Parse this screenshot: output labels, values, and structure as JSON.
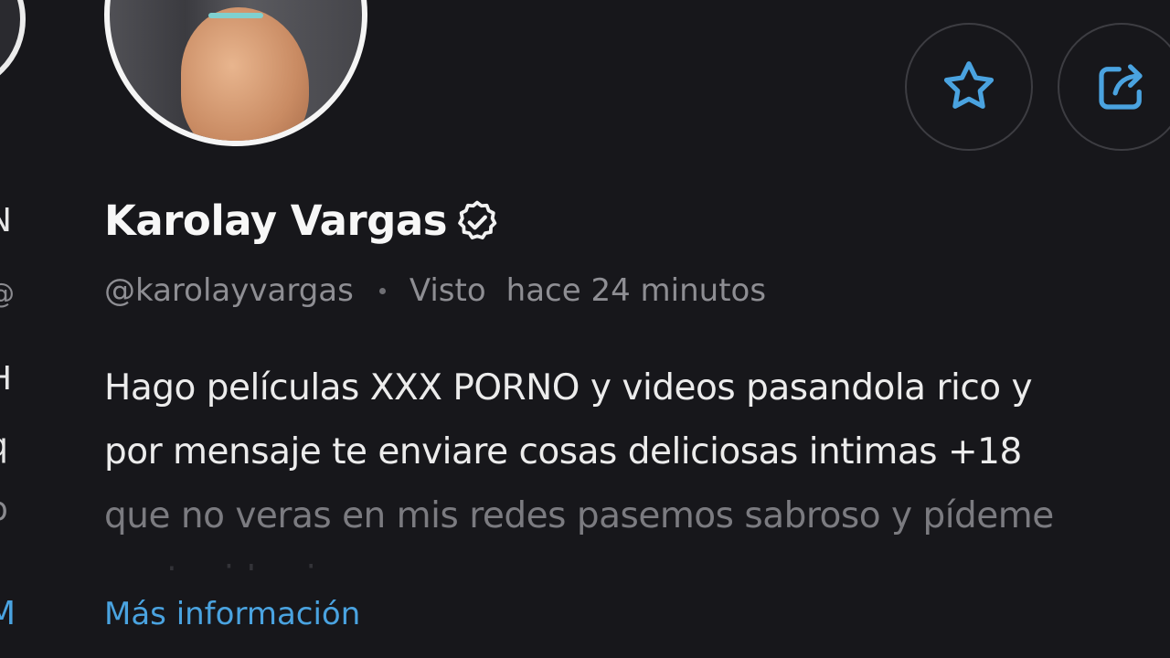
{
  "profile": {
    "name": "Karolay Vargas",
    "handle": "@karolayvargas",
    "last_seen_label": "Visto",
    "last_seen_time": "hace 24 minutos",
    "bio_lines": [
      "Hago películas XXX PORNO y videos pasandola rico y",
      "por mensaje te enviare cosas deliciosas intimas +18",
      "que no veras en mis redes pasemos sabroso y pídeme",
      "contenido sin censura"
    ],
    "more_info_label": "Más información"
  },
  "edge_column": {
    "chars": [
      "N",
      "@",
      "H",
      "q",
      "p",
      "M"
    ]
  },
  "icons": {
    "star": "star-icon",
    "share": "share-icon",
    "verified": "verified-badge-icon"
  },
  "colors": {
    "background": "#17171b",
    "accent": "#4aa3e0",
    "muted_text": "#8e8e93"
  }
}
